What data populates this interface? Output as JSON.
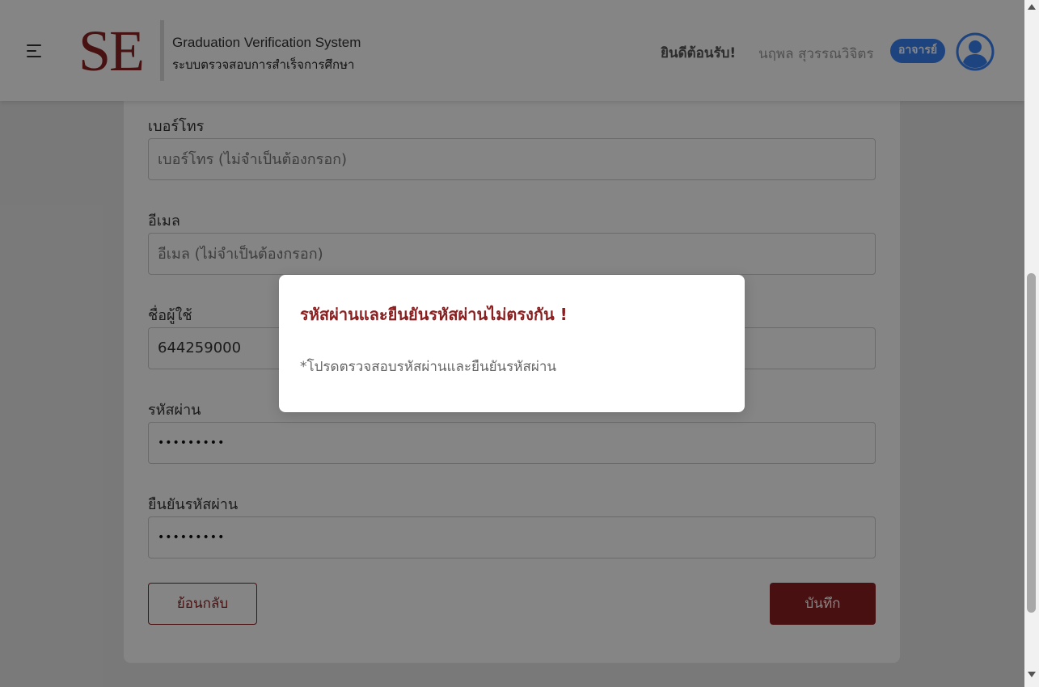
{
  "header": {
    "logo_text": "SE",
    "title_en": "Graduation Verification System",
    "title_th": "ระบบตรวจสอบการสำเร็จการศึกษา",
    "welcome_text": "ยินดีต้อนรับ!",
    "user_name": "นฤพล สุวรรณวิจิตร",
    "role_badge": "อาจารย์",
    "icons": {
      "menu": "hamburger-menu-icon",
      "avatar": "user-avatar-icon"
    }
  },
  "form": {
    "phone": {
      "label": "เบอร์โทร",
      "value": "",
      "placeholder": "เบอร์โทร (ไม่จำเป็นต้องกรอก)"
    },
    "email": {
      "label": "อีเมล",
      "value": "",
      "placeholder": "อีเมล (ไม่จำเป็นต้องกรอก)"
    },
    "username": {
      "label": "ชื่อผู้ใช้",
      "value": "644259000"
    },
    "password": {
      "label": "รหัสผ่าน",
      "value": "•••••••••"
    },
    "confirm_password": {
      "label": "ยืนยันรหัสผ่าน",
      "value": "•••••••••"
    },
    "back_button": "ย้อนกลับ",
    "save_button": "บันทึก"
  },
  "modal": {
    "title": "รหัสผ่านและยืนยันรหัสผ่านไม่ตรงกัน !",
    "message": "*โปรดตรวจสอบรหัสผ่านและยืนยันรหัสผ่าน"
  },
  "colors": {
    "brand": "#8b2323",
    "badge": "#3b82f6",
    "avatar": "#3b82f6"
  }
}
